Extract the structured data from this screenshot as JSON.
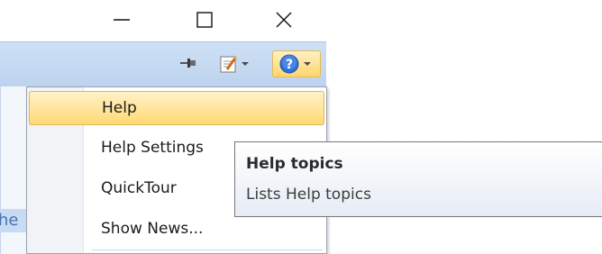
{
  "window_controls": {
    "minimize_icon": "minimize-icon",
    "maximize_icon": "maximize-icon",
    "close_icon": "close-icon"
  },
  "toolbar": {
    "pin_icon": "pin-icon",
    "edit_icon": "edit-icon",
    "help_icon": "help-icon"
  },
  "background": {
    "partial_text": "he"
  },
  "menu": {
    "items": [
      {
        "label": "Help",
        "active": true
      },
      {
        "label": "Help Settings",
        "active": false
      },
      {
        "label": "QuickTour",
        "active": false
      },
      {
        "label": "Show News...",
        "active": false
      }
    ]
  },
  "tooltip": {
    "title": "Help topics",
    "description": "Lists Help topics"
  },
  "colors": {
    "highlight": "#ffd974",
    "highlight_border": "#e2b756",
    "ribbon": "#bcd3ee",
    "help_icon_blue": "#2f6fd6"
  }
}
